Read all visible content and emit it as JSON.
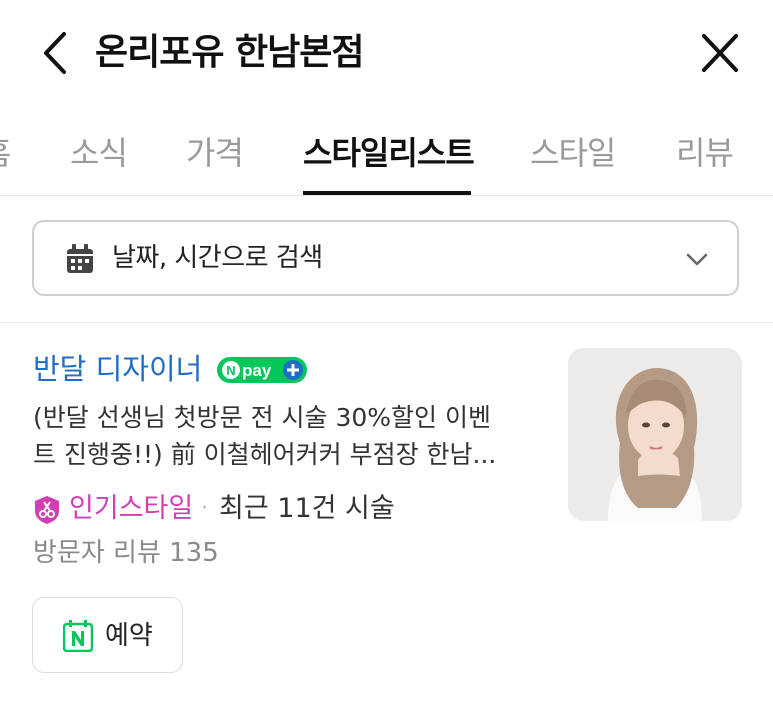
{
  "header": {
    "title": "온리포유 한남본점",
    "back_icon": "chevron-left-icon",
    "close_icon": "close-icon"
  },
  "tabs": [
    {
      "label": "홈",
      "active": false
    },
    {
      "label": "소식",
      "active": false
    },
    {
      "label": "가격",
      "active": false
    },
    {
      "label": "스타일리스트",
      "active": true
    },
    {
      "label": "스타일",
      "active": false
    },
    {
      "label": "리뷰",
      "active": false
    }
  ],
  "search": {
    "label": "날짜, 시간으로 검색",
    "icon": "calendar-icon",
    "dropdown_icon": "chevron-down-icon"
  },
  "stylist": {
    "name": "반달 디자이너",
    "npay_text": "pay",
    "description_line1": "(반달 선생님 첫방문 전 시술 30%할인 이벤",
    "description_line2": "트 진행중!!) 前 이철헤어커커 부점장 한남...",
    "badge_label": "인기스타일",
    "separator": "·",
    "recent": "최근 11건 시술",
    "reviews": "방문자 리뷰 135",
    "book_label": "예약"
  },
  "colors": {
    "accent_blue": "#1e6ec8",
    "naver_green": "#03c75a",
    "badge_pink": "#d23fb4"
  }
}
